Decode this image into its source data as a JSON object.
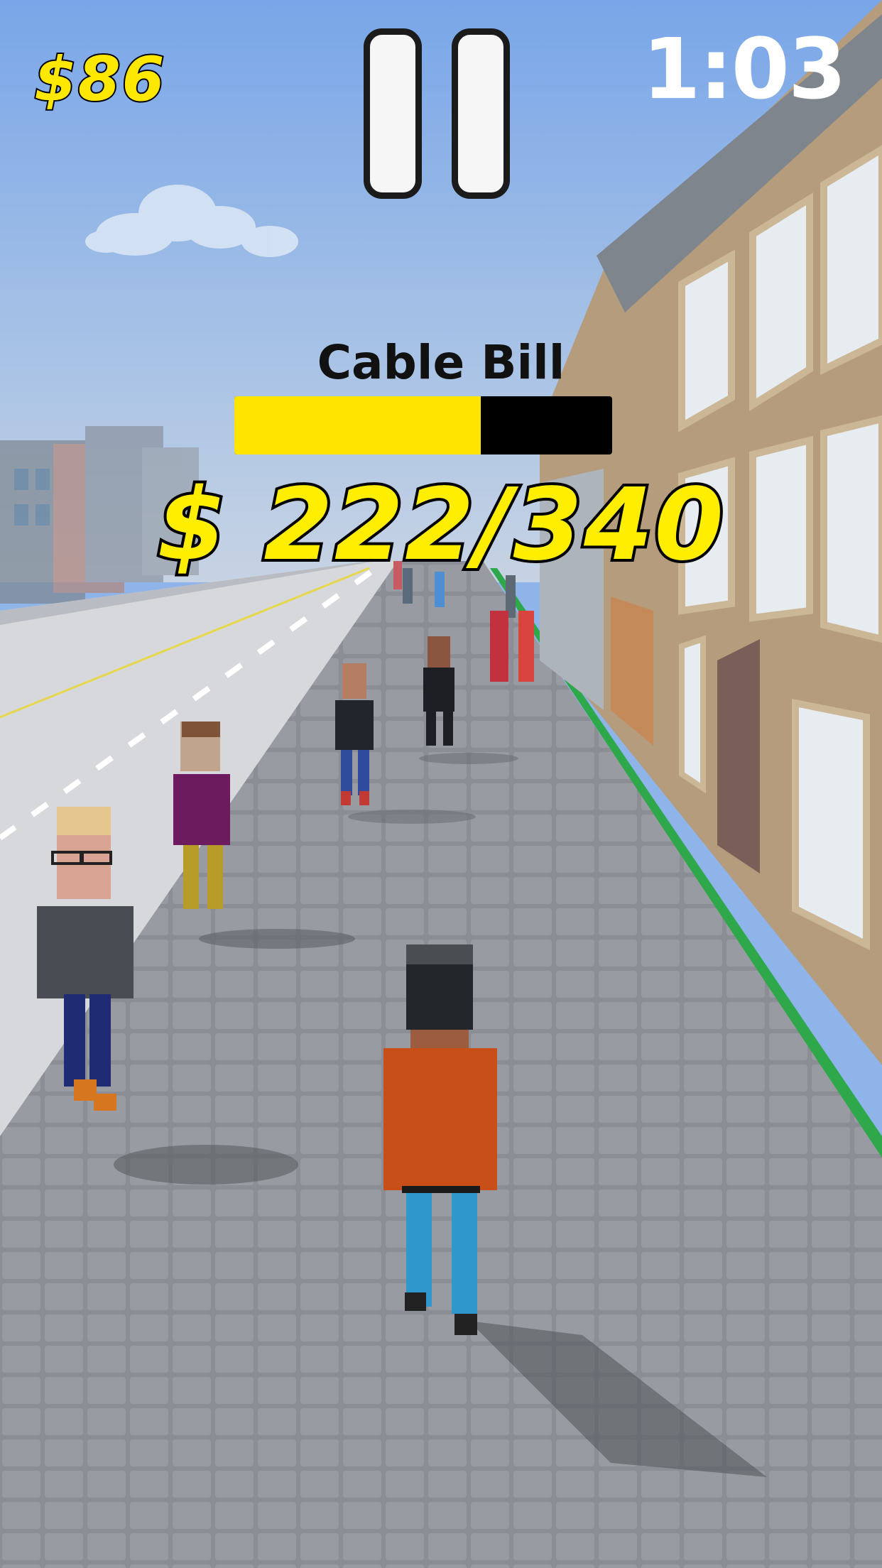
{
  "hud": {
    "money": "$86",
    "timer": "1:03"
  },
  "bill": {
    "title": "Cable Bill",
    "amount_text": "$ 222/340",
    "paid": 222,
    "total": 340
  },
  "colors": {
    "hud_yellow": "#ffe800",
    "bar_fill": "#ffe500",
    "bar_track": "#000000",
    "sky": "#8fb4ea",
    "sidewalk": "#8a8e95",
    "curb_green": "#2ea84a"
  },
  "icons": {
    "pause": "pause-icon"
  }
}
